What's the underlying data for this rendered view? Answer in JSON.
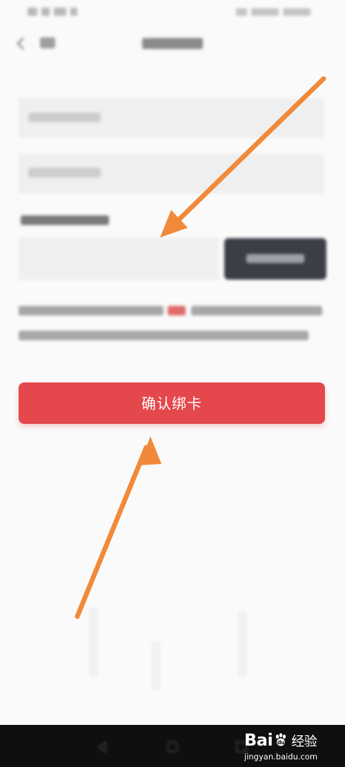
{
  "confirm_button": {
    "label": "确认绑卡",
    "color": "#e4484c"
  },
  "code_button": {
    "color": "#3b3d47"
  },
  "annotation": {
    "arrow_color": "#f08a3a"
  },
  "watermark": {
    "brand_bai": "Bai",
    "brand_du": "du",
    "brand_suffix": "经验",
    "domain": "jingyan.baidu.com"
  },
  "icons": {
    "back": "chevron-left-icon",
    "nav_back": "triangle-back-icon",
    "nav_home": "circle-home-icon",
    "nav_recent": "square-recent-icon",
    "paw": "paw-icon"
  }
}
